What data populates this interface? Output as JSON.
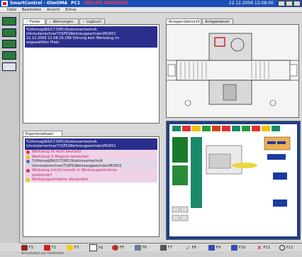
{
  "titlebar": {
    "app_name": "SmartControl - OlmOMA",
    "pc": "PC1",
    "fault_title": "FEHLER ANZEIGEN",
    "datetime": "22.12.2006 12:08:00"
  },
  "menu": [
    "Datei",
    "Bearbeiten",
    "Ansicht",
    "Extras"
  ],
  "fault_panel": {
    "tabs": [
      "Fehler",
      "Warnungen",
      "Logbuch"
    ],
    "active_tab": "Fehler",
    "messages": [
      "%\\Homag\\BA2\\72\\M1\\Stationsantechnik",
      "Umrouterrechner\\T\\SPS\\Werkzeugwechsler\\MU051",
      "22.12.2006 12:08:16.188  Störung kein Werkzeug im",
      "angewählten Platz"
    ]
  },
  "expert_panel": {
    "tab": "Expertenwissen",
    "header_lines": [
      "%\\Homag\\BA2\\72\\M1\\Stationsantechnik",
      "Umrouterrechner\\T\\SPS\\Werkzeugwechsler\\MU051"
    ],
    "rows": [
      {
        "text": "Werkzeug ist nicht bestückt",
        "style": "pink"
      },
      {
        "text": "Werkzeug in Magazin bestücken",
        "style": "pink"
      },
      {
        "text": "%\\Homag\\BA2\\72\\M1\\Stationsantechnik",
        "style": "normal"
      },
      {
        "text": "Umrouterrechner\\T\\SPS\\Werkzeugwechsler\\MU051",
        "style": "normal"
      },
      {
        "text": "Werkzeug (nicht) korrekt in Werkzeugaufnahme",
        "style": "pink"
      },
      {
        "text": "positioniert",
        "style": "pink"
      },
      {
        "text": "Werkzeugaufnahme überprüfen",
        "style": "pink"
      }
    ]
  },
  "machine_panel": {
    "tabs": [
      "Anlagenübersicht",
      "Anlagenbaum"
    ],
    "active_tab": "Anlagenübersicht"
  },
  "fkeys": [
    {
      "label": "F1",
      "icon": "wrench-icon"
    },
    {
      "label": "F2",
      "icon": "error-icon"
    },
    {
      "label": "F3",
      "icon": "bulb-icon"
    },
    {
      "label": "F4",
      "icon": "page-icon"
    },
    {
      "label": "F5",
      "icon": "gears-icon"
    },
    {
      "label": "F6",
      "icon": "edit-icon"
    },
    {
      "label": "F7",
      "icon": "tools-icon"
    },
    {
      "label": "F8",
      "icon": "check-icon"
    },
    {
      "label": "F9",
      "icon": "diagram-icon"
    },
    {
      "label": "F10",
      "icon": "diagram2-icon"
    },
    {
      "label": "F11",
      "icon": "cross-icon"
    },
    {
      "label": "F12",
      "icon": "search-icon"
    }
  ],
  "statusbar": {
    "text": "Umschalten zur Fehlerliste"
  },
  "colors": {
    "titlebar": "#1b4fb5",
    "selection": "#2a2f8d",
    "expert_pink": "#c21b6b"
  }
}
